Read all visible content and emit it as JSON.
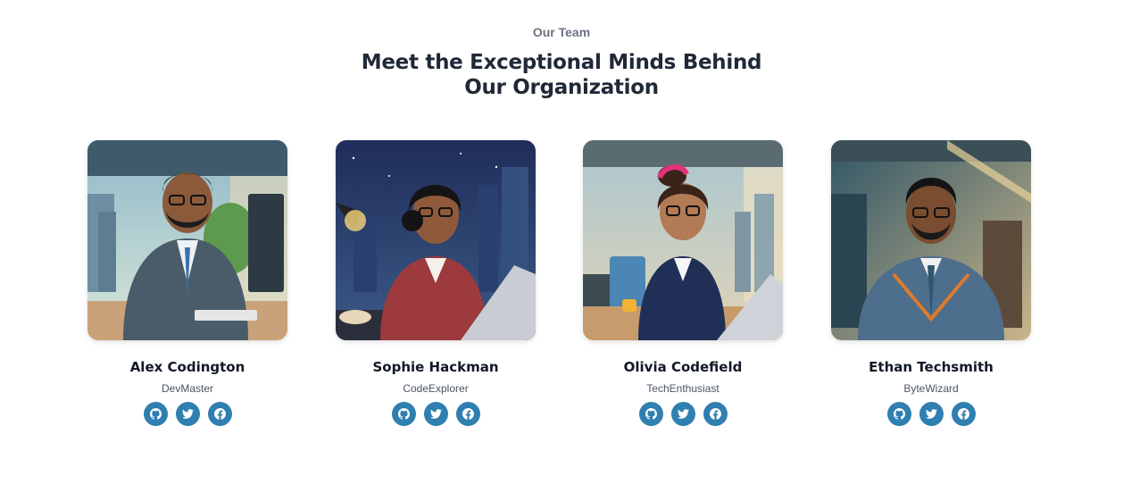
{
  "section": {
    "eyebrow": "Our Team",
    "title": "Meet the Exceptional Minds Behind Our Organization"
  },
  "members": [
    {
      "name": "Alex Codington",
      "role": "DevMaster",
      "socials": [
        "github-icon",
        "twitter-icon",
        "facebook-icon"
      ]
    },
    {
      "name": "Sophie Hackman",
      "role": "CodeExplorer",
      "socials": [
        "github-icon",
        "twitter-icon",
        "facebook-icon"
      ]
    },
    {
      "name": "Olivia Codefield",
      "role": "TechEnthusiast",
      "socials": [
        "github-icon",
        "twitter-icon",
        "facebook-icon"
      ]
    },
    {
      "name": "Ethan Techsmith",
      "role": "ByteWizard",
      "socials": [
        "github-icon",
        "twitter-icon",
        "facebook-icon"
      ]
    }
  ],
  "colors": {
    "social_button": "#2f7fb1",
    "heading": "#1f2937",
    "eyebrow": "#6b7280"
  }
}
